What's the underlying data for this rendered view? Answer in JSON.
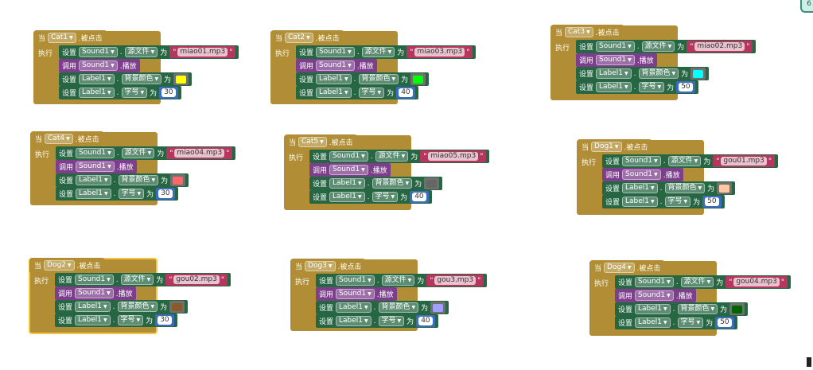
{
  "labels": {
    "when": "当",
    "clicked": ".被点击",
    "do": "执行",
    "set": "设置",
    "call": "调用",
    "to": "为",
    "dot": ".",
    "play": ".播放",
    "source": "源文件",
    "bgcolor": "背景颜色",
    "fontsize": "字号"
  },
  "blocks": [
    {
      "button": "Cat1",
      "sound": "Sound1",
      "label": "Label1",
      "file": "miao01.mp3",
      "color": "#ffff00",
      "size": "30"
    },
    {
      "button": "Cat2",
      "sound": "Sound1",
      "label": "Label1",
      "file": "miao03.mp3",
      "color": "#00ff00",
      "size": "40"
    },
    {
      "button": "Cat3",
      "sound": "Sound1",
      "label": "Label1",
      "file": "miao02.mp3",
      "color": "#00ffff",
      "size": "50"
    },
    {
      "button": "Cat4",
      "sound": "Sound1",
      "label": "Label1",
      "file": "miao04.mp3",
      "color": "#ff6666",
      "size": "30"
    },
    {
      "button": "Cat5",
      "sound": "Sound1",
      "label": "Label1",
      "file": "miao05.mp3",
      "color": "#666666",
      "size": "40"
    },
    {
      "button": "Dog1",
      "sound": "Sound1",
      "label": "Label1",
      "file": "gou01.mp3",
      "color": "#ffc8a0",
      "size": "50"
    },
    {
      "button": "Dog2",
      "sound": "Sound1",
      "label": "Label1",
      "file": "gou02.mp3",
      "color": "#8b5a2b",
      "size": "30"
    },
    {
      "button": "Dog3",
      "sound": "Sound1",
      "label": "Label1",
      "file": "gou3.mp3",
      "color": "#a0a0ff",
      "size": "40"
    },
    {
      "button": "Dog4",
      "sound": "Sound1",
      "label": "Label1",
      "file": "gou04.mp3",
      "color": "#006400",
      "size": "50"
    }
  ],
  "corner_icon": "6"
}
